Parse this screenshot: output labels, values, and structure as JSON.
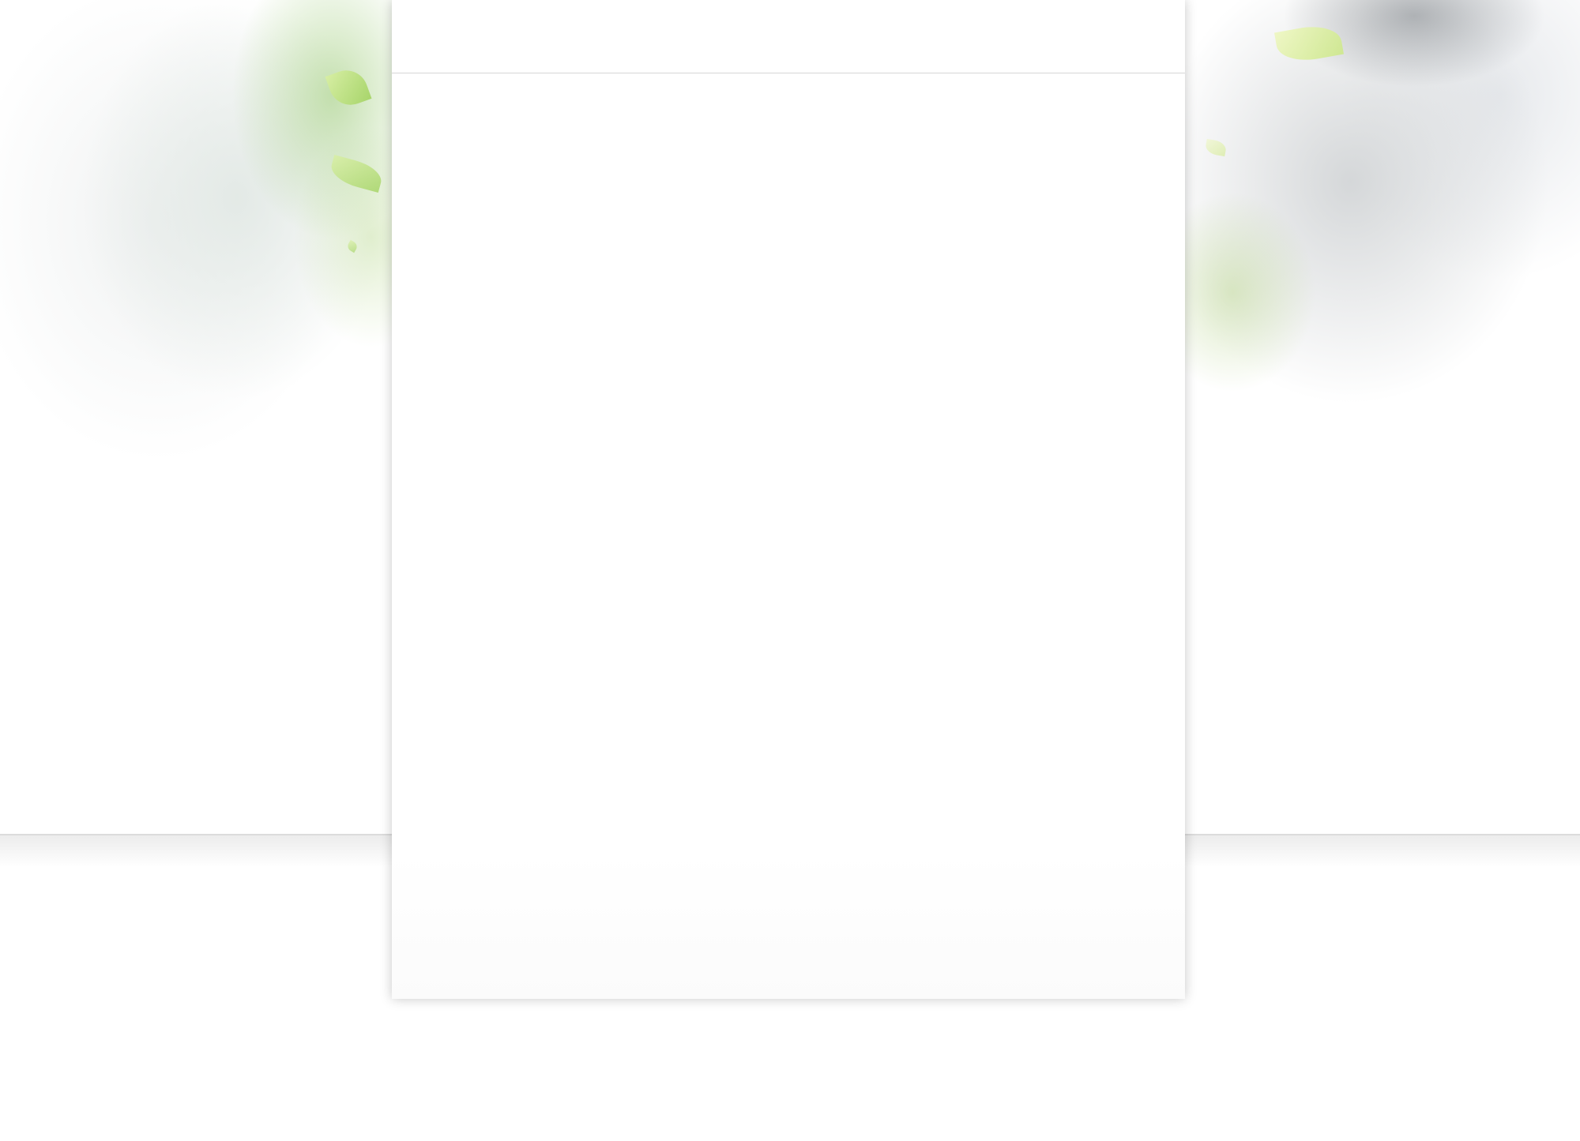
{
  "page": {
    "header": {},
    "body": {},
    "footer": {}
  },
  "decorations": {
    "left_background": "green-foliage-mist",
    "right_background": "grey-foliage-mist",
    "leaf_color": "#9fd15a"
  },
  "colors": {
    "page_background": "#ffffff",
    "panel_background": "#ffffff",
    "divider": "#d6d6d6"
  }
}
